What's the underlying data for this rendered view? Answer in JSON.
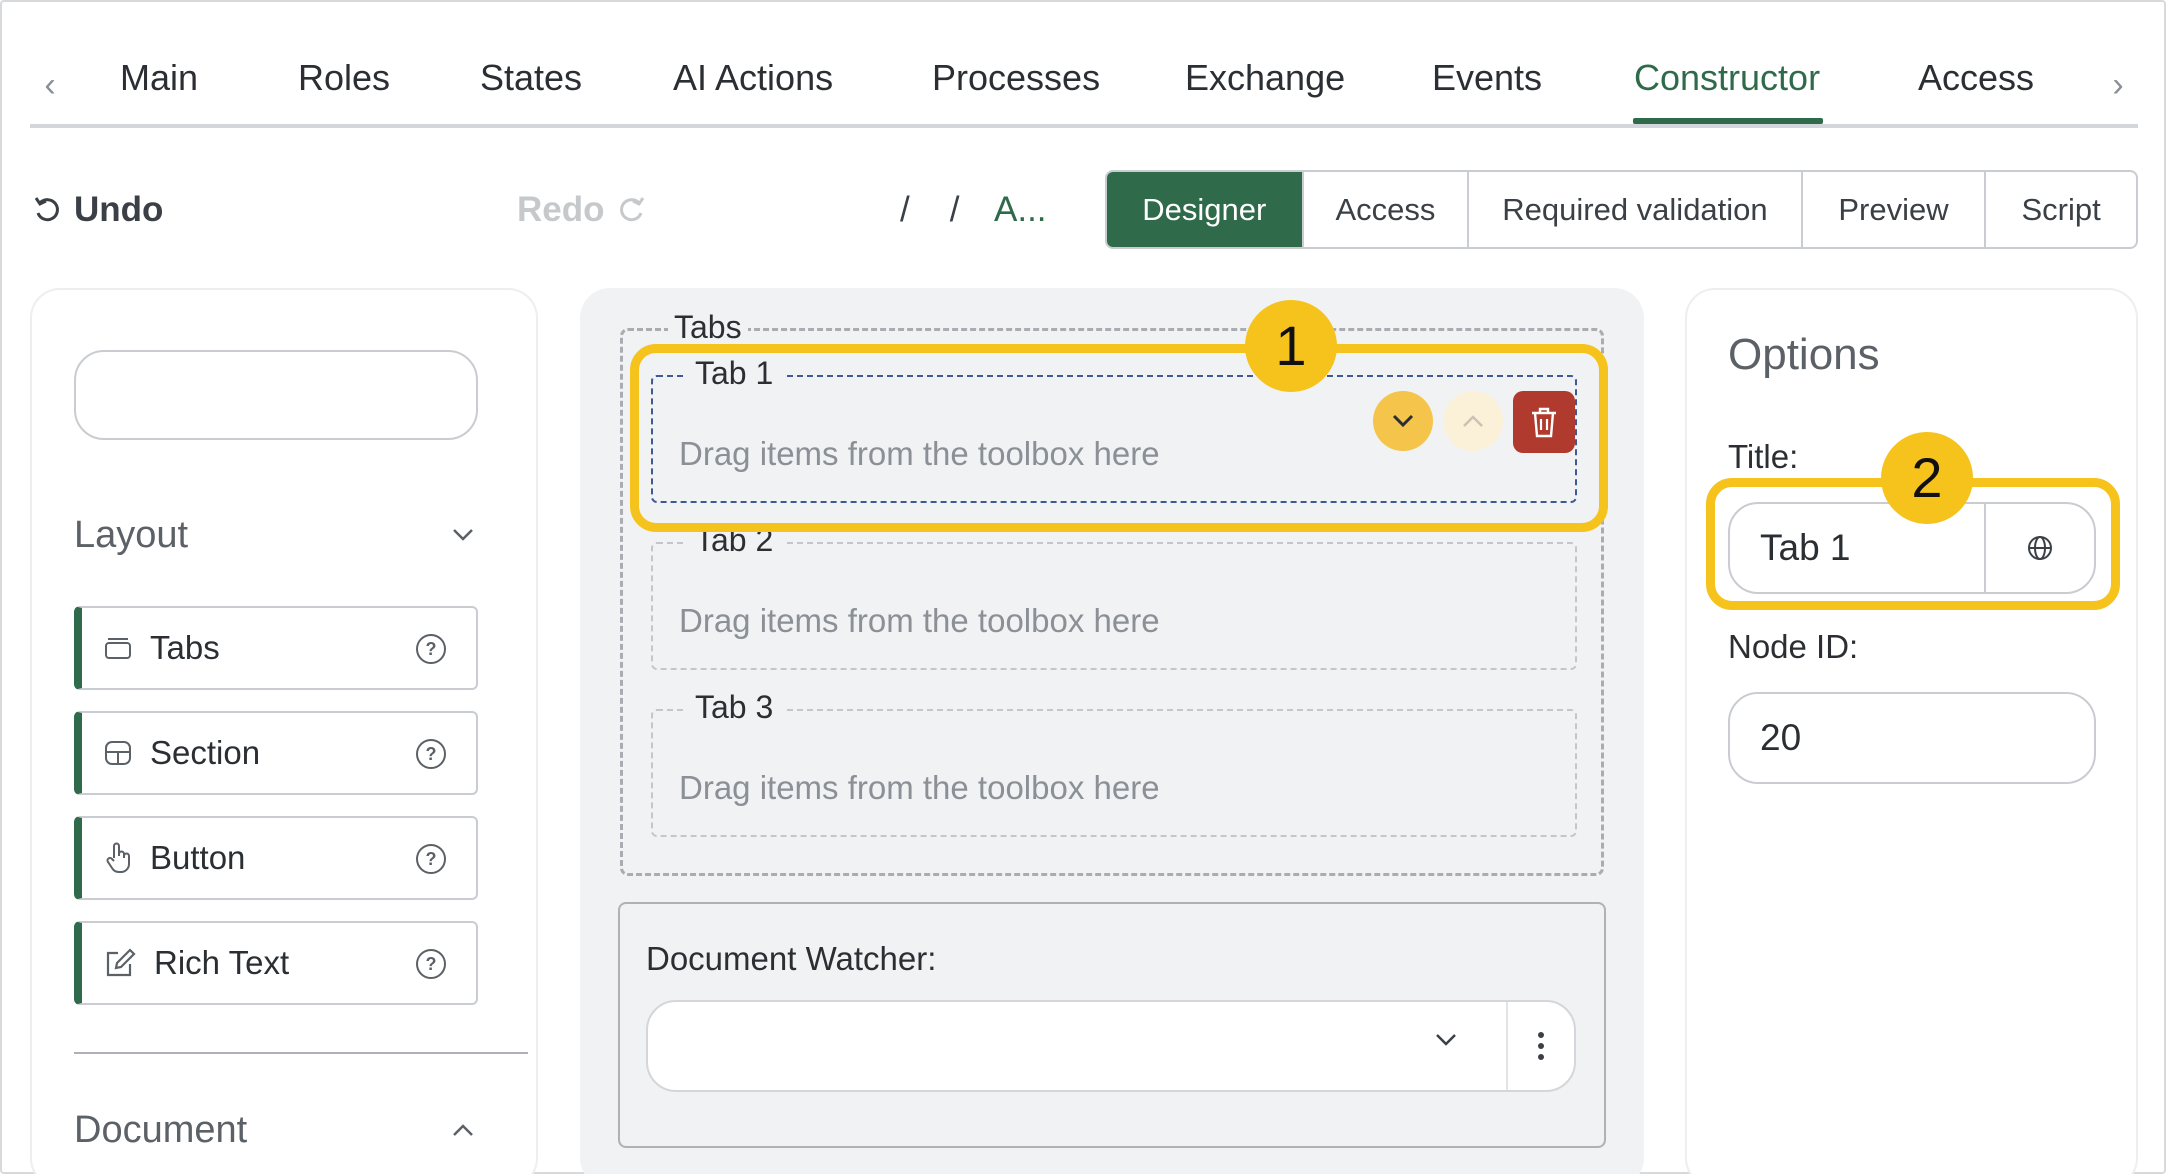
{
  "nav": {
    "tabs": [
      "Main",
      "Roles",
      "States",
      "AI Actions",
      "Processes",
      "Exchange",
      "Events",
      "Constructor",
      "Access"
    ],
    "active": "Constructor"
  },
  "toolbar": {
    "undo_label": "Undo",
    "redo_label": "Redo",
    "crumb_sep": "/",
    "crumb_link": "A...",
    "modes": [
      "Designer",
      "Access",
      "Required validation",
      "Preview",
      "Script"
    ],
    "active_mode": "Designer"
  },
  "toolbox": {
    "search_value": "",
    "layout_label": "Layout",
    "items": [
      {
        "label": "Tabs",
        "icon": "tabs-icon"
      },
      {
        "label": "Section",
        "icon": "section-icon"
      },
      {
        "label": "Button",
        "icon": "pointer-hand-icon"
      },
      {
        "label": "Rich Text",
        "icon": "edit-icon"
      }
    ],
    "document_label": "Document"
  },
  "canvas": {
    "tabs_legend": "Tabs",
    "slots": [
      {
        "title": "Tab 1",
        "hint": "Drag items from the toolbox here"
      },
      {
        "title": "Tab 2",
        "hint": "Drag items from the toolbox here"
      },
      {
        "title": "Tab 3",
        "hint": "Drag items from the toolbox here"
      }
    ],
    "watcher_label": "Document Watcher:",
    "watcher_value": ""
  },
  "options": {
    "heading": "Options",
    "title_label": "Title:",
    "title_value": "Tab 1",
    "node_label": "Node ID:",
    "node_value": "20"
  },
  "callouts": {
    "first": "1",
    "second": "2"
  },
  "colors": {
    "accent": "#2f6b4a",
    "highlight": "#f6c21c",
    "delete": "#b03a2e"
  }
}
